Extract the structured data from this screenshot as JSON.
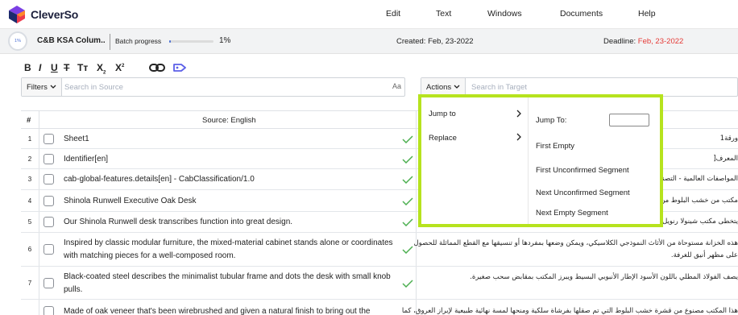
{
  "app": {
    "name": "CleverSo"
  },
  "menu": [
    "Edit",
    "Text",
    "Windows",
    "Documents",
    "Help"
  ],
  "project": {
    "progress_circle": "1%",
    "name": "C&B KSA Colum..",
    "batch_label": "Batch progress",
    "batch_progress": 0.01,
    "batch_pct": "1%",
    "created": "Created: Feb, 23-2022",
    "deadline_label": "Deadline: ",
    "deadline_date": "Feb, 23-2022"
  },
  "toolbar": {
    "bold": "B",
    "italic": "I",
    "underline": "U",
    "strike": "T",
    "case": "Tт",
    "subscript": "X",
    "superscript": "X"
  },
  "source_search": {
    "dropdown": "Filters",
    "placeholder": "Search in Source",
    "case_toggle": "Aa"
  },
  "target_search": {
    "dropdown": "Actions",
    "placeholder": "Search in Target"
  },
  "table": {
    "col_num": "#",
    "col_source": "Source: English",
    "rows": [
      {
        "num": "1",
        "source": "Sheet1",
        "target": "ورقة1",
        "confirmed": true
      },
      {
        "num": "2",
        "source": "Identifier[en]",
        "target": "المعرف[",
        "confirmed": true
      },
      {
        "num": "3",
        "source": "cab-global-features.details[en] - CabClassification/1.0",
        "target": "المواصفات العالمية - التصنيف",
        "confirmed": true
      },
      {
        "num": "4",
        "source": "Shinola Runwell Executive Oak Desk",
        "target": "مكتب من خشب البلوط من شينولا",
        "confirmed": true
      },
      {
        "num": "5",
        "source": "Our Shinola Runwell desk transcribes function into great design.",
        "target": "يتخطى مكتب شينولا رنويل التنفيذي",
        "confirmed": true
      },
      {
        "num": "6",
        "source": "Inspired by classic modular furniture, the mixed-material cabinet stands alone or coordinates with matching pieces for a well-composed room.",
        "target": "هذه الخزانة مستوحاة من الأثاث النموذجي الكلاسيكي، ويمكن وضعها بمفردها أو تنسيقها مع القطع المماثلة للحصول على مظهر أنيق للغرفة.",
        "confirmed": true
      },
      {
        "num": "7",
        "source": "Black-coated steel describes the minimalist tubular frame and dots the desk with small knob pulls.",
        "target": "يصف الفولاذ المطلي باللون الأسود الإطار الأنبوبي البسيط ويبرز المكتب بمقابض سحب صغيرة.",
        "confirmed": true
      },
      {
        "num": "",
        "source": "Made of oak veneer that's been wirebrushed and given a natural finish to bring out the",
        "target": "هذا المكتب مصنوع من قشرة خشب البلوط التي تم صقلها بفرشاة سلكية ومنحها لمسة نهائية طبيعية لإبراز العروق، كما يوفر",
        "confirmed": false
      }
    ]
  },
  "popup": {
    "menu": [
      "Jump to",
      "Replace"
    ],
    "jump_to_label": "Jump To:",
    "jump_to_value": "",
    "options": [
      "First Empty",
      "First Unconfirmed Segment",
      "Next Unconfirmed Segment",
      "Next Empty Segment"
    ],
    "highlight_color": "#b6e31e"
  },
  "colors": {
    "accent": "#4a6fd4",
    "deadline": "#e53935",
    "check": "#4caf50",
    "tag_icon": "#5b5fe8"
  }
}
